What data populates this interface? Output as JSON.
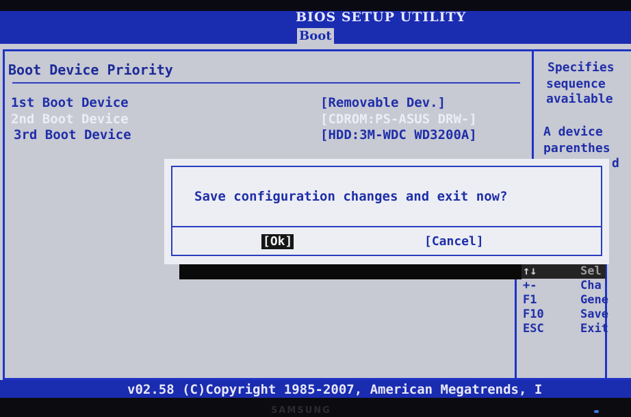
{
  "window": {
    "title": "BIOS SETUP UTILITY"
  },
  "tabs": [
    {
      "label": "Boot",
      "active": true
    }
  ],
  "main": {
    "section_title": "Boot Device Priority",
    "boot_devices": [
      {
        "label": "1st Boot Device",
        "value": "[Removable Dev.]",
        "selected": false
      },
      {
        "label": "2nd Boot Device",
        "value": "[CDROM:PS-ASUS DRW-]",
        "selected": true
      },
      {
        "label": "3rd Boot Device",
        "value": "[HDD:3M-WDC WD3200A]",
        "selected": false
      }
    ]
  },
  "help": {
    "lines": [
      "Specifies",
      "sequence",
      "available",
      "",
      "A device",
      "parenthes",
      "d"
    ]
  },
  "keys": [
    {
      "key": "↑↓",
      "desc": "Sel"
    },
    {
      "key": "+-",
      "desc": "Cha"
    },
    {
      "key": "F1",
      "desc": "Gene"
    },
    {
      "key": "F10",
      "desc": "Save"
    },
    {
      "key": "ESC",
      "desc": "Exit"
    }
  ],
  "dialog": {
    "message": "Save configuration changes and exit now?",
    "ok_label": "[Ok]",
    "cancel_label": "[Cancel]"
  },
  "footer": {
    "text": "v02.58 (C)Copyright 1985-2007, American Megatrends, I"
  },
  "bezel": {
    "brand": "SAMSUNG"
  },
  "colors": {
    "bios_blue": "#1a2cb0",
    "bios_gray": "#c7c9d3",
    "text_blue": "#1f2ea8",
    "highlight_white": "#ecedf6"
  }
}
